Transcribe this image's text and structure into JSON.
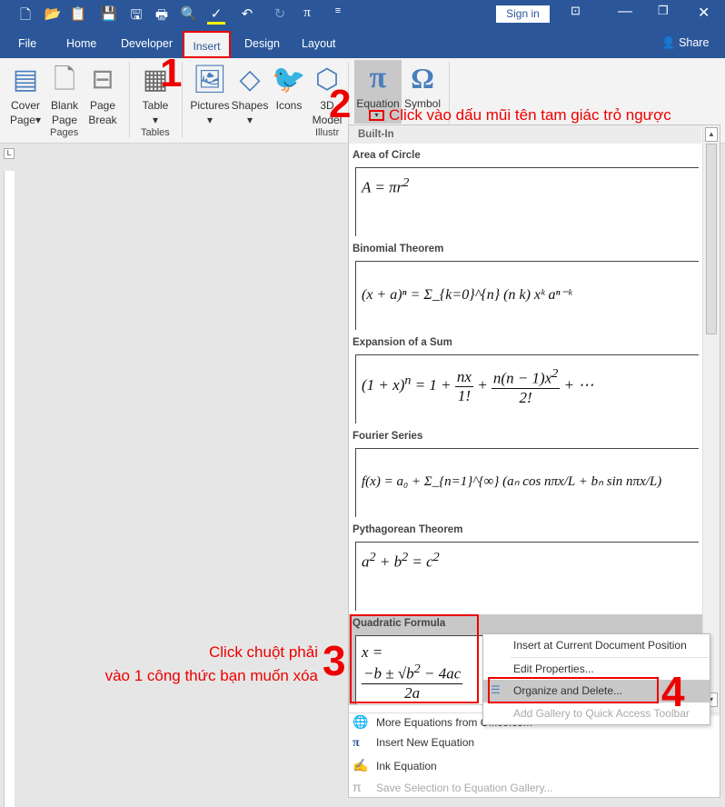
{
  "titlebar": {
    "quick_access_icons": [
      "new-doc-icon",
      "open-icon",
      "paste-icon",
      "save-icon",
      "save-as-icon",
      "print-icon",
      "print-preview-icon",
      "spelling-icon",
      "undo-icon",
      "redo-icon",
      "equation-icon",
      "customize-icon"
    ],
    "sign_in": "Sign in",
    "window_controls": [
      "ribbon-display-icon",
      "minimize-icon",
      "restore-icon",
      "close-icon"
    ]
  },
  "tabs": {
    "items": [
      "File",
      "Home",
      "Developer",
      "Insert",
      "Design",
      "Layout"
    ],
    "active": "Insert",
    "share": "Share"
  },
  "ribbon": {
    "cover_page": "Cover\nPage",
    "blank_page_1": "Blank",
    "blank_page_2": "Page",
    "page_break_1": "Page",
    "page_break_2": "Break",
    "cover_1": "Cover",
    "cover_2": "Page",
    "pages": "Pages",
    "table": "Table",
    "tables": "Tables",
    "pictures": "Pictures",
    "shapes": "Shapes",
    "icons": "Icons",
    "model_1": "3D",
    "model_2": "Model",
    "illustr": "Illustr",
    "equation": "Equation",
    "symbol": "Symbol"
  },
  "annotations": {
    "n1": "1",
    "n2": "2",
    "n2_text": "Click vào dấu mũi tên tam giác trỏ ngược",
    "n3": "3",
    "n3_line1": "Click chuột phải",
    "n3_line2": "vào 1 công thức bạn muốn xóa",
    "n4": "4",
    "color": "#e00000"
  },
  "gallery": {
    "header": "Built-In",
    "items": [
      {
        "label": "Area of Circle",
        "formula": "A = πr²"
      },
      {
        "label": "Binomial Theorem",
        "formula": "(x + a)ⁿ = Σ_{k=0}^{n} (n k) xᵏ aⁿ⁻ᵏ"
      },
      {
        "label": "Expansion of a Sum",
        "formula": "(1 + x)ⁿ = 1 + nx/1! + n(n − 1)x²/2! + ⋯"
      },
      {
        "label": "Fourier Series",
        "formula": "f(x) = a₀ + Σ_{n=1}^{∞} (aₙ cos nπx/L + bₙ sin nπx/L)"
      },
      {
        "label": "Pythagorean Theorem",
        "formula": "a² + b² = c²"
      },
      {
        "label": "Quadratic Formula",
        "formula": "x = (−b ± √(b² − 4ac))/2a"
      }
    ],
    "footer": [
      {
        "label": "More Equations from Office.com",
        "icon": "office-icon",
        "disabled": false
      },
      {
        "label": "Insert New Equation",
        "icon": "pi-icon",
        "disabled": false
      },
      {
        "label": "Ink Equation",
        "icon": "ink-icon",
        "disabled": false
      },
      {
        "label": "Save Selection to Equation Gallery...",
        "icon": "save-selection-icon",
        "disabled": true
      }
    ]
  },
  "context_menu": {
    "items": [
      {
        "label": "Insert at Current Document Position",
        "disabled": false
      },
      {
        "label": "Edit Properties...",
        "disabled": false
      },
      {
        "label": "Organize and Delete...",
        "disabled": false,
        "highlighted": true
      },
      {
        "label": "Add Gallery to Quick Access Toolbar",
        "disabled": true
      }
    ]
  },
  "colors": {
    "title_blue": "#2b579a",
    "ribbon_bg": "#f3f3f3",
    "selection": "#c8c8c8"
  }
}
